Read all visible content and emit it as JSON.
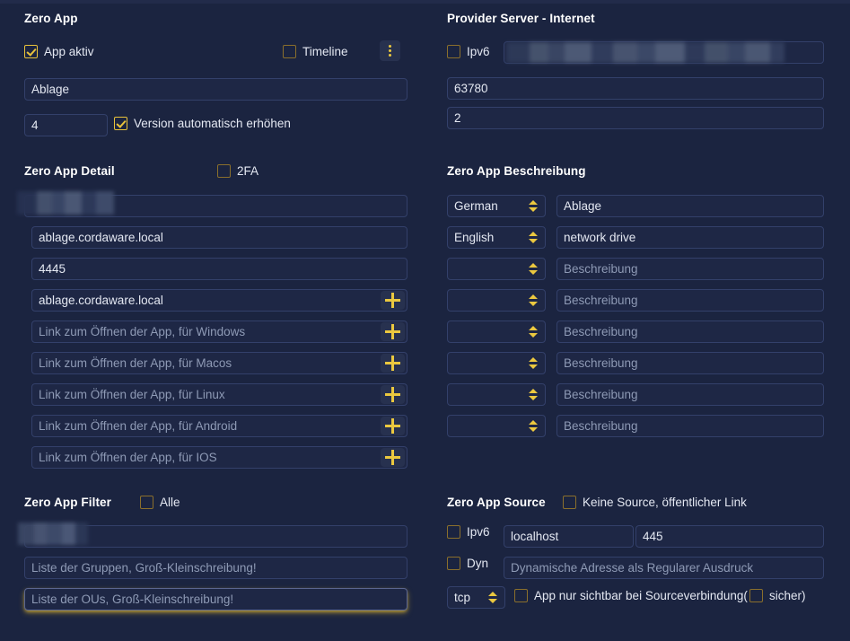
{
  "theme": {
    "background": "#1b2440",
    "field_bg": "#1e2745",
    "field_border": "#33406a",
    "accent": "#ebc83f",
    "text": "#e4e8f2",
    "placeholder": "#8e9ab5"
  },
  "left": {
    "app": {
      "title": "Zero App",
      "app_active": {
        "label": "App aktiv",
        "checked": true
      },
      "timeline": {
        "label": "Timeline",
        "checked": false
      },
      "menu_icon": "kebab-menu-icon",
      "name_value": "Ablage",
      "version_value": "4",
      "auto_version": {
        "label": "Version automatisch erhöhen",
        "checked": true
      }
    },
    "detail": {
      "title": "Zero App Detail",
      "twofa": {
        "label": "2FA",
        "checked": false
      },
      "redacted_value": "",
      "host_value": "ablage.cordaware.local",
      "port_value": "4445",
      "links": [
        {
          "value": "ablage.cordaware.local",
          "placeholder": "",
          "add_icon": "plus-icon"
        },
        {
          "value": "",
          "placeholder": "Link zum Öffnen der App, für Windows",
          "add_icon": "plus-icon"
        },
        {
          "value": "",
          "placeholder": "Link zum Öffnen der App, für Macos",
          "add_icon": "plus-icon"
        },
        {
          "value": "",
          "placeholder": "Link zum Öffnen der App, für Linux",
          "add_icon": "plus-icon"
        },
        {
          "value": "",
          "placeholder": "Link zum Öffnen der App, für Android",
          "add_icon": "plus-icon"
        },
        {
          "value": "",
          "placeholder": "Link zum Öffnen der App, für IOS",
          "add_icon": "plus-icon"
        }
      ]
    },
    "filter": {
      "title": "Zero App Filter",
      "all": {
        "label": "Alle",
        "checked": false
      },
      "redacted_value": "",
      "groups_placeholder": "Liste der Gruppen, Groß-Kleinschreibung!",
      "ous_placeholder": "Liste der OUs, Groß-Kleinschreibung!"
    }
  },
  "right": {
    "provider": {
      "title": "Provider Server - Internet",
      "ipv6": {
        "label": "Ipv6",
        "checked": false
      },
      "address_value": "",
      "port_value": "63780",
      "count_value": "2"
    },
    "description": {
      "title": "Zero App Beschreibung",
      "placeholder": "Beschreibung",
      "rows": [
        {
          "language": "German",
          "text": "Ablage"
        },
        {
          "language": "English",
          "text": "network drive"
        },
        {
          "language": "",
          "text": ""
        },
        {
          "language": "",
          "text": ""
        },
        {
          "language": "",
          "text": ""
        },
        {
          "language": "",
          "text": ""
        },
        {
          "language": "",
          "text": ""
        },
        {
          "language": "",
          "text": ""
        }
      ]
    },
    "source": {
      "title": "Zero App Source",
      "no_source": {
        "label": "Keine Source, öffentlicher Link",
        "checked": false
      },
      "ipv6": {
        "label": "Ipv6",
        "checked": false
      },
      "host_value": "localhost",
      "port_value": "445",
      "dyn": {
        "label": "Dyn",
        "checked": false
      },
      "dyn_placeholder": "Dynamische Adresse als Regularer Ausdruck",
      "protocol": "tcp",
      "visible_only": {
        "label": "App nur sichtbar bei Sourceverbindung(",
        "checked": false
      },
      "secure": {
        "label": "sicher)",
        "checked": false
      }
    }
  }
}
